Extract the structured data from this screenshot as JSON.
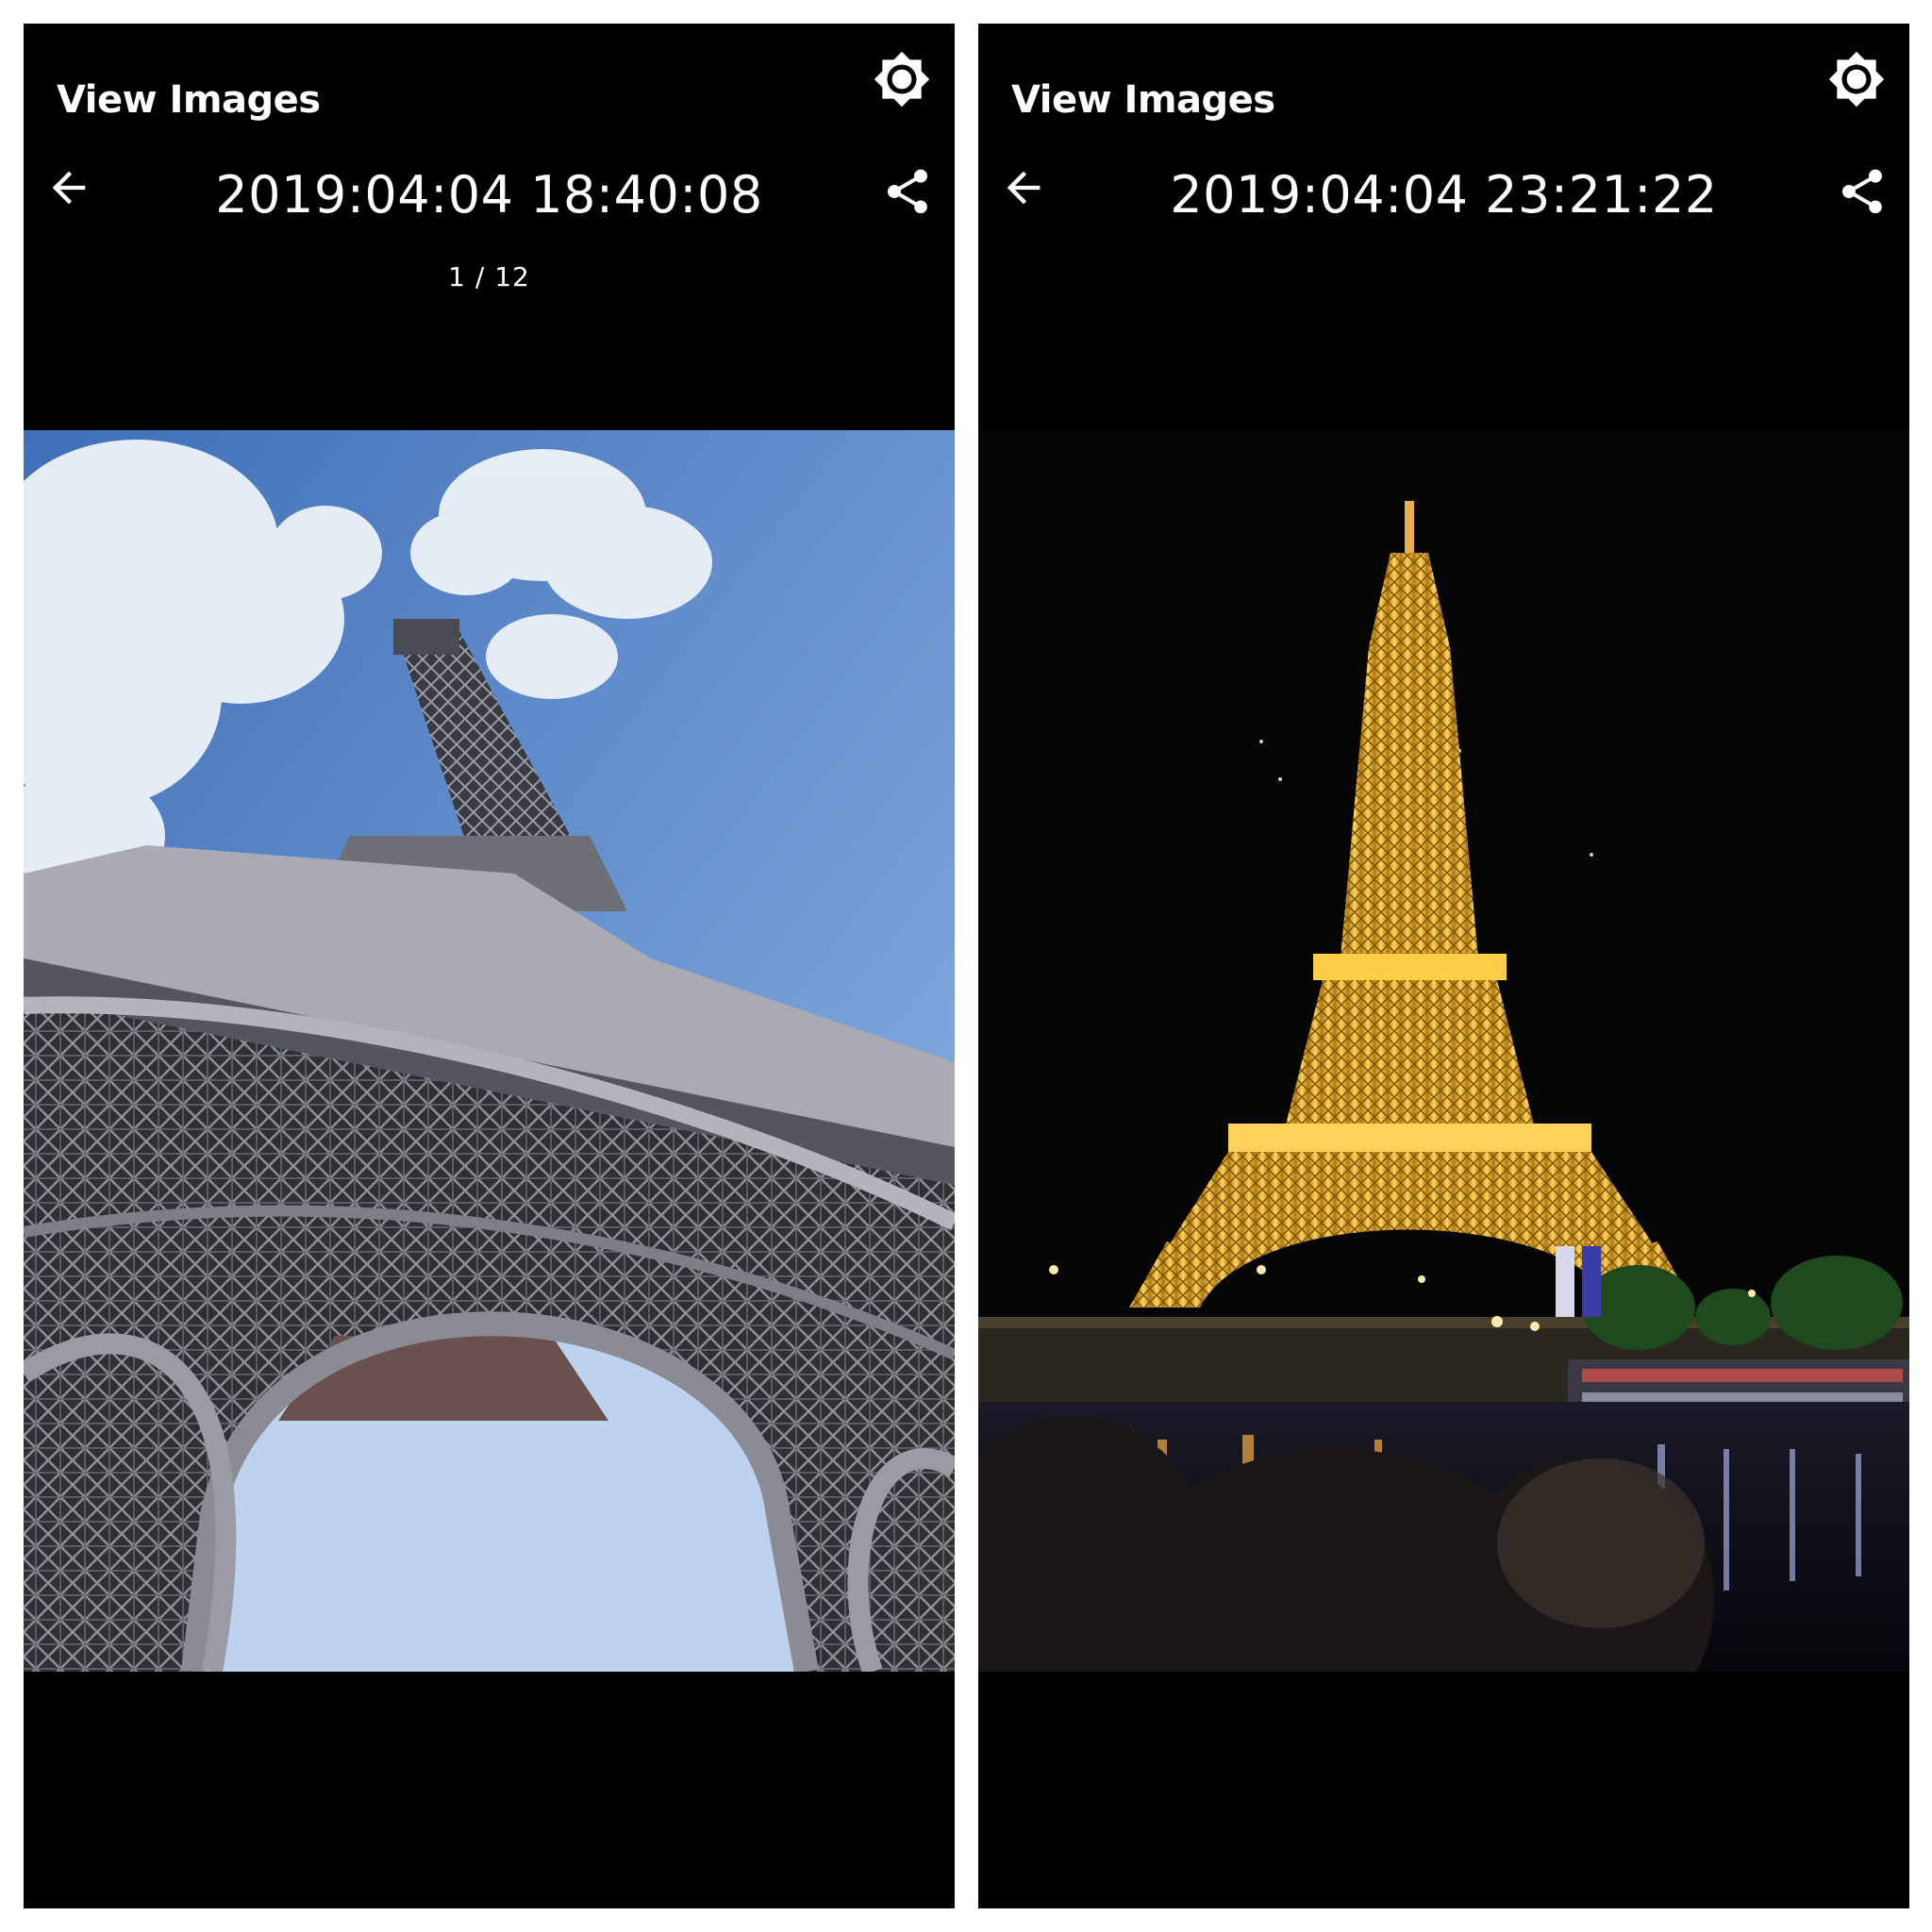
{
  "left_viewer": {
    "app_title": "View Images",
    "timestamp": "2019:04:04 18:40:08",
    "counter": "1 / 12",
    "photo_subject": "Eiffel Tower from below, daytime blue sky with clouds"
  },
  "right_viewer": {
    "app_title": "View Images",
    "timestamp": "2019:04:04 23:21:22",
    "photo_subject": "Eiffel Tower illuminated at night over the Seine"
  },
  "icons": {
    "settings": "gear-icon",
    "back": "arrow-left-icon",
    "share": "share-icon"
  },
  "colors": {
    "background": "#000000",
    "text": "#ffffff",
    "sky": "#4a7fc8",
    "tower_day": "#5a5a62",
    "tower_night": "#f2b630"
  }
}
